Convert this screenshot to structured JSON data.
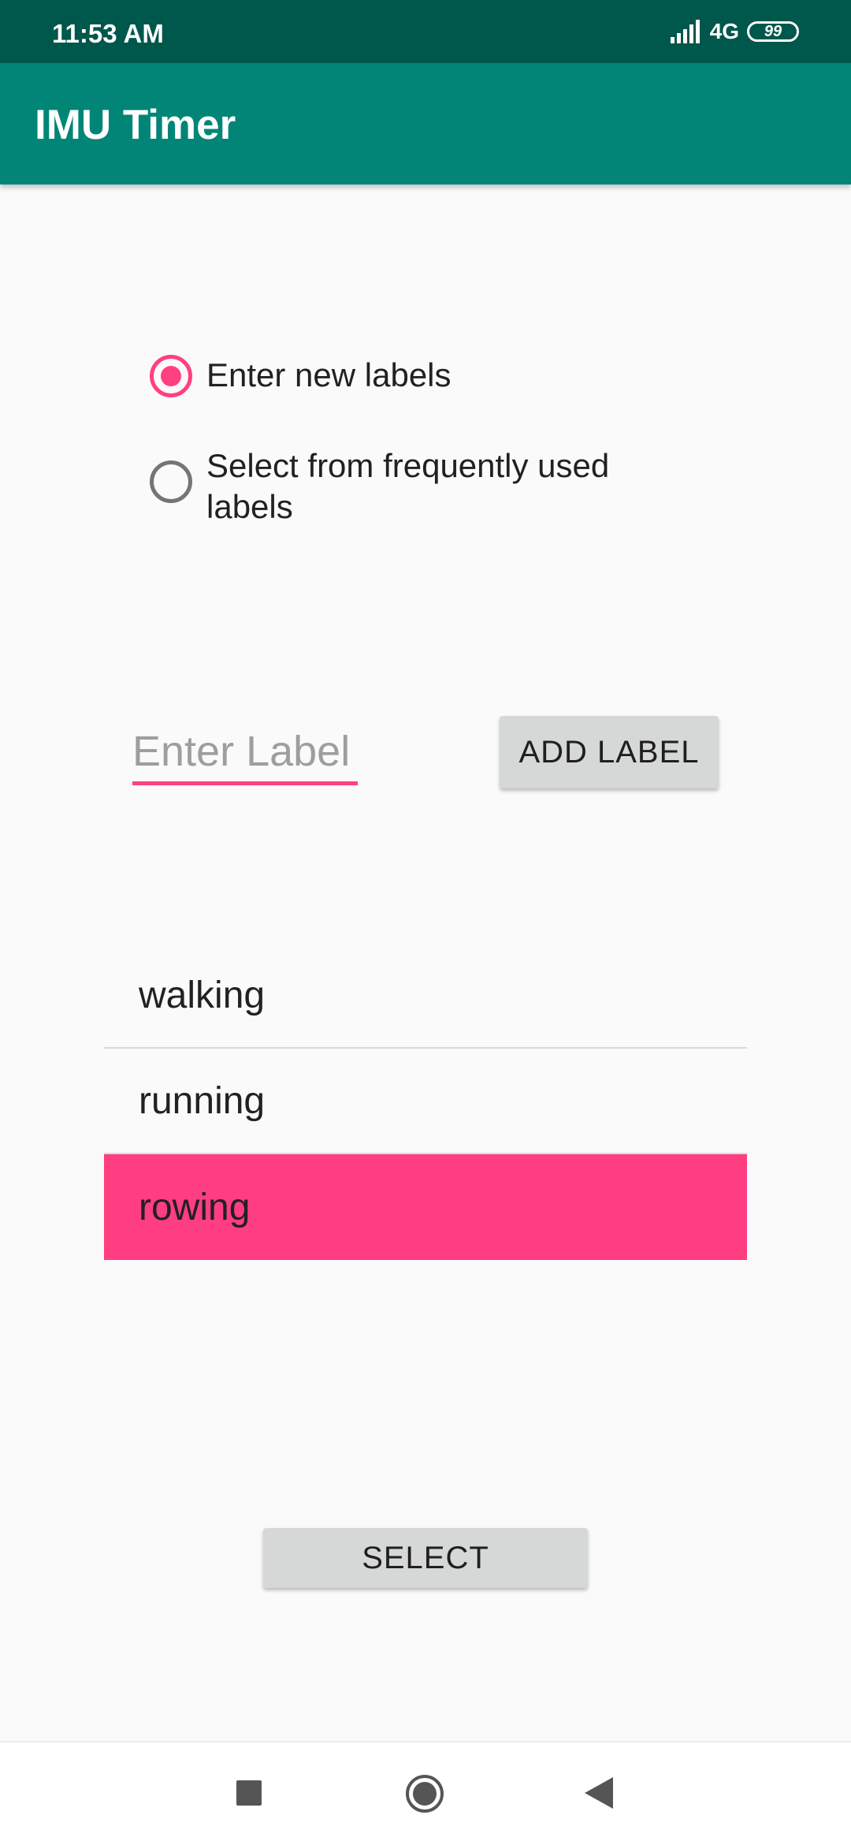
{
  "status_bar": {
    "time": "11:53 AM",
    "network_type": "4G",
    "battery_level": "99",
    "signal_icon": "signal-bars-icon"
  },
  "app_bar": {
    "title": "IMU Timer"
  },
  "label_mode": {
    "options": [
      {
        "label": "Enter new labels",
        "checked": true
      },
      {
        "label": "Select from frequently used labels",
        "checked": false
      }
    ]
  },
  "label_entry": {
    "placeholder": "Enter Label",
    "value": "",
    "add_button_label": "ADD LABEL"
  },
  "labels": {
    "items": [
      {
        "label": "walking",
        "selected": false
      },
      {
        "label": "running",
        "selected": false
      },
      {
        "label": "rowing",
        "selected": true
      }
    ]
  },
  "select_button_label": "SELECT",
  "nav_bar": {
    "icons": [
      "recents-square-icon",
      "home-circle-icon",
      "back-triangle-icon"
    ]
  },
  "colors": {
    "status_bar": "#00574b",
    "app_bar": "#008577",
    "accent": "#ff4081",
    "selected_row": "#ff3d81",
    "button": "#d6d7d7"
  }
}
